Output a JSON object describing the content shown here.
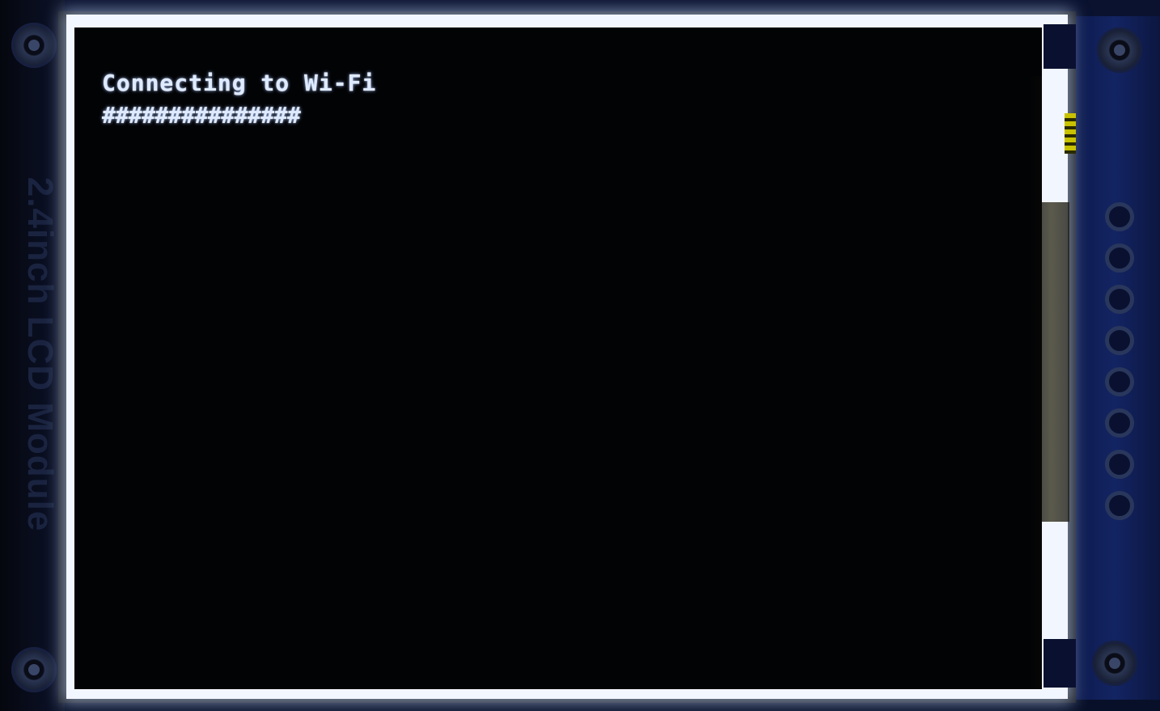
{
  "module": {
    "silkscreen_label": "2.4inch LCD Module"
  },
  "screen": {
    "status_text": "Connecting to Wi-Fi",
    "progress_text": "###############"
  },
  "colors": {
    "screen_background": "#020305",
    "text": "#dfeaff",
    "backlight": "#f2f6ff",
    "pcb": "#132463"
  }
}
